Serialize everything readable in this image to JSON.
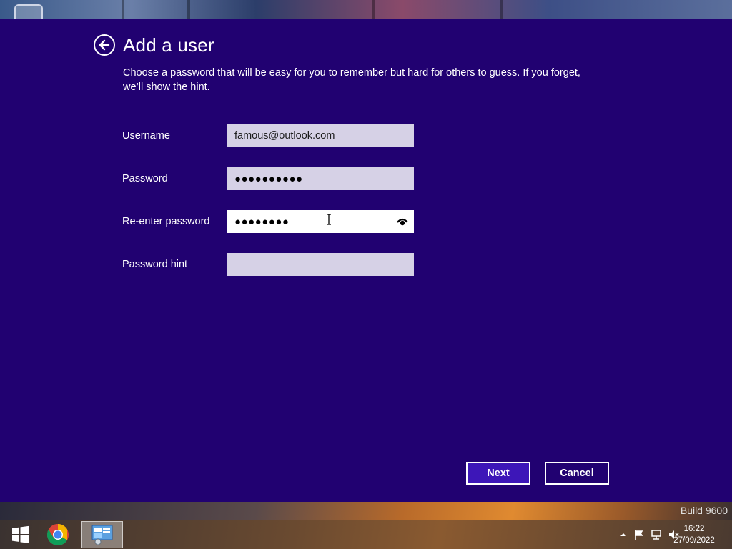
{
  "dialog": {
    "title": "Add a user",
    "description": "Choose a password that will be easy for you to remember but hard for others to guess. If you forget, we’ll show the hint.",
    "fields": {
      "username": {
        "label": "Username",
        "value": "famous@outlook.com"
      },
      "password": {
        "label": "Password",
        "value": "●●●●●●●●●●"
      },
      "reenter": {
        "label": "Re-enter password",
        "value": "●●●●●●●●"
      },
      "hint": {
        "label": "Password hint",
        "value": ""
      }
    },
    "buttons": {
      "next": "Next",
      "cancel": "Cancel"
    },
    "colors": {
      "background": "#210171",
      "field": "#d6d1e6",
      "next_button": "#3d16b8"
    }
  },
  "desktop": {
    "build_label": "Build 9600"
  },
  "taskbar": {
    "items": [
      "windows-start-icon",
      "chrome-icon",
      "control-panel-icon"
    ],
    "tray_icons": [
      "show-hidden-icons-icon",
      "action-center-flag-icon",
      "network-icon",
      "volume-muted-icon"
    ],
    "clock": {
      "time": "16:22",
      "date": "27/09/2022"
    }
  }
}
